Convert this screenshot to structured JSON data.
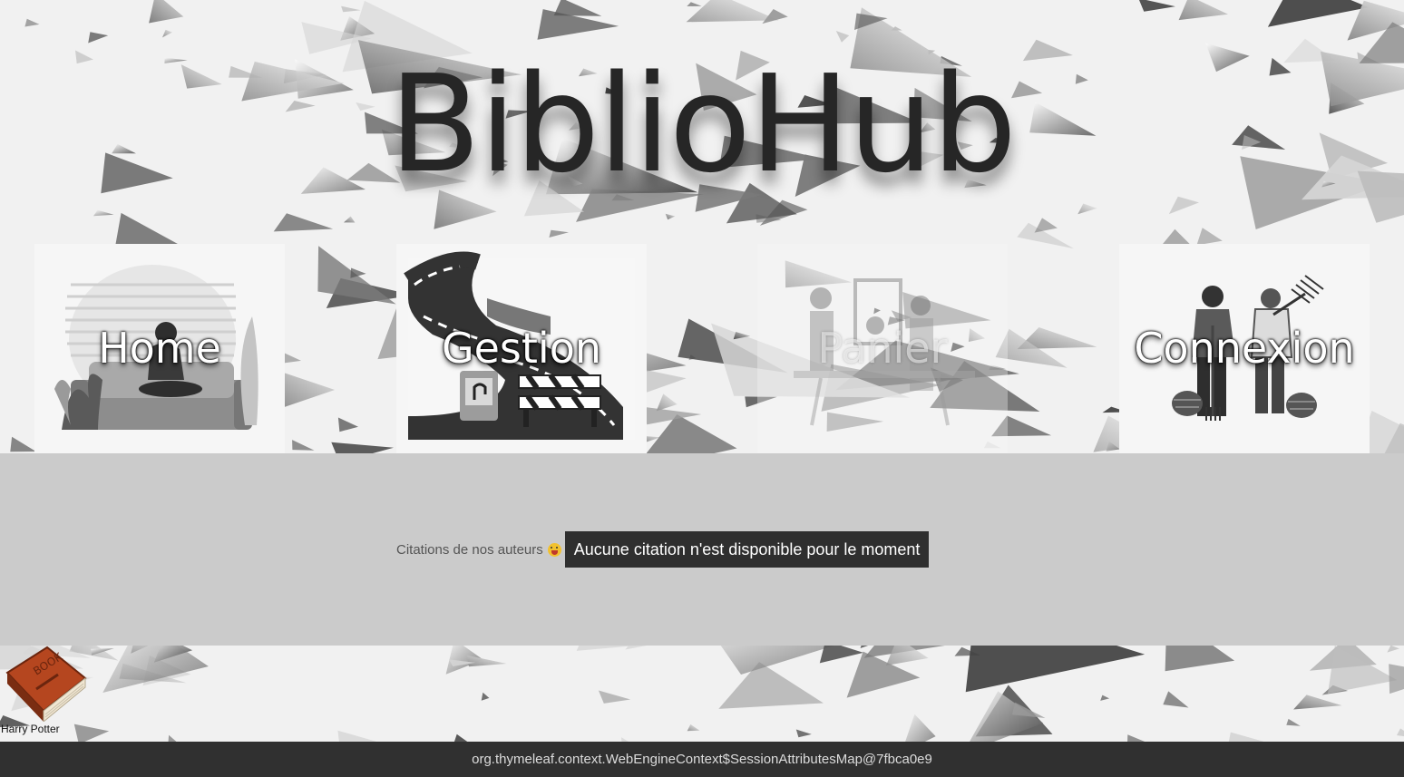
{
  "header": {
    "title": "BiblioHub"
  },
  "nav": [
    {
      "label": "Home",
      "icon": "person-on-couch-icon"
    },
    {
      "label": "Gestion",
      "icon": "road-construction-icon"
    },
    {
      "label": "Panier",
      "icon": "shop-workers-icon"
    },
    {
      "label": "Connexion",
      "icon": "farmers-icon"
    }
  ],
  "quotes": {
    "label": "Citations de nos auteurs",
    "emoji": "tongue-out-emoji",
    "message": "Aucune citation n'est disponible pour le moment"
  },
  "books": [
    {
      "title": "Harry Potter",
      "icon": "book-icon"
    }
  ],
  "footer": {
    "text": "org.thymeleaf.context.WebEngineContext$SessionAttributesMap@7fbca0e9"
  },
  "colors": {
    "band": "#cbcbcb",
    "footer": "#303030",
    "quote_box": "#2f2f2f",
    "book": "#b5461f"
  }
}
